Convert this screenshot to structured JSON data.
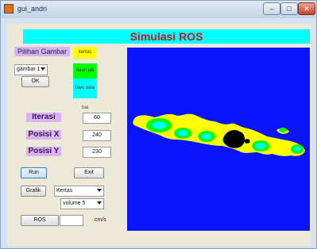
{
  "window": {
    "title": "gui_andri",
    "controls": {
      "minimize": "–",
      "maximize": "□",
      "close": "✕"
    }
  },
  "header": {
    "title": "Simulasi ROS"
  },
  "picture_select": {
    "label": "Pilihan Gambar",
    "selected": "gambar 1",
    "ok_label": "OK"
  },
  "legend": {
    "yellow": "kertas",
    "green": "daun jati",
    "cyan": "layu usia tua"
  },
  "params": {
    "iterasi": {
      "label": "Iterasi",
      "value": "60"
    },
    "posisi_x": {
      "label": "Posisi X",
      "value": "240"
    },
    "posisi_y": {
      "label": "Posisi Y",
      "value": "230"
    }
  },
  "actions": {
    "run_label": "Run",
    "exit_label": "Exit"
  },
  "graph": {
    "button_label": "Grafik",
    "type_selected": "Kertas",
    "volume_selected": "volume 5"
  },
  "ros": {
    "button_label": "ROS",
    "value": "",
    "unit": "cm/s"
  },
  "colors": {
    "header_bg": "#00ffff",
    "header_text": "#c8141e",
    "label_bg": "#d9b3ff",
    "map_background": "#0a14ff",
    "fuel_yellow": "#ffff00",
    "fuel_green": "#00ff00",
    "fuel_cyan": "#00ffff",
    "burned": "#000000"
  },
  "map": {
    "description_icon": "java-island-fire-map"
  }
}
